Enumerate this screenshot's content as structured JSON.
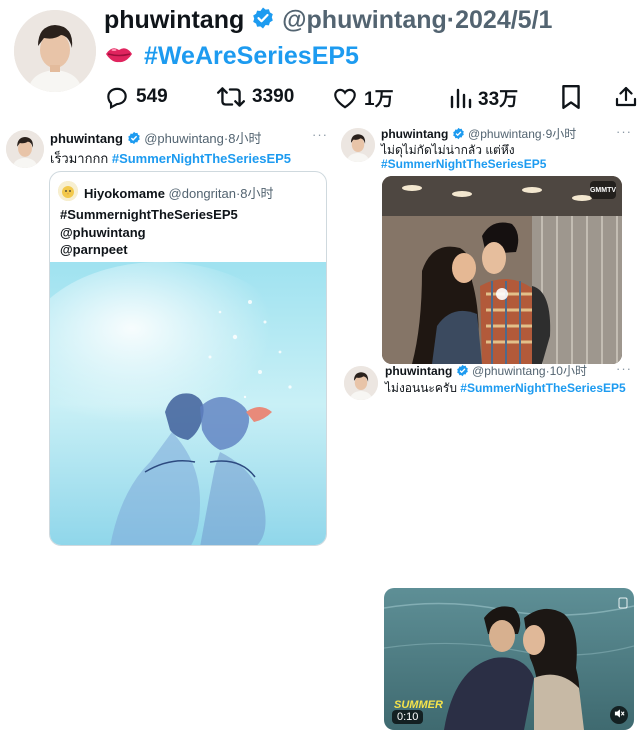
{
  "main": {
    "display_name": "phuwintang",
    "handle": "@phuwintang",
    "separator": "·",
    "date": "2024/5/1",
    "hashtag": "#WeAreSeriesEP5",
    "emoji_icon": "kiss-lips-icon",
    "actions": {
      "replies": "549",
      "retweets": "3390",
      "likes": "1万",
      "views": "33万"
    }
  },
  "left_tweet": {
    "display_name": "phuwintang",
    "handle": "@phuwintang",
    "time": "8小时",
    "text_prefix": "เร็วมากกก",
    "hashtag": "#SummerNightTheSeriesEP5",
    "more": "···",
    "quote": {
      "display_name": "Hiyokomame",
      "handle": "@dongritan",
      "time": "8小时",
      "lines": [
        "#SummernightTheSeriesEP5",
        "@phuwintang",
        "@parnpeet"
      ]
    }
  },
  "right_top_tweet": {
    "display_name": "phuwintang",
    "handle": "@phuwintang",
    "time": "9小时",
    "text": "ไม่ดุไม่กัดไม่น่ากลัว แต่หึง",
    "hashtag": "#SummerNightTheSeriesEP5",
    "more": "···",
    "media_badge": "GMMTV"
  },
  "right_bottom_tweet": {
    "display_name": "phuwintang",
    "handle": "@phuwintang",
    "time": "10小时",
    "text_prefix": "ไม่งอนนะครับ",
    "hashtag": "#SummerNightTheSeriesEP5",
    "more": "···",
    "video_duration": "0:10",
    "video_logo": "SUMMER"
  },
  "colors": {
    "accent": "#1d9bf0",
    "text": "#0f1419",
    "muted": "#536471"
  }
}
